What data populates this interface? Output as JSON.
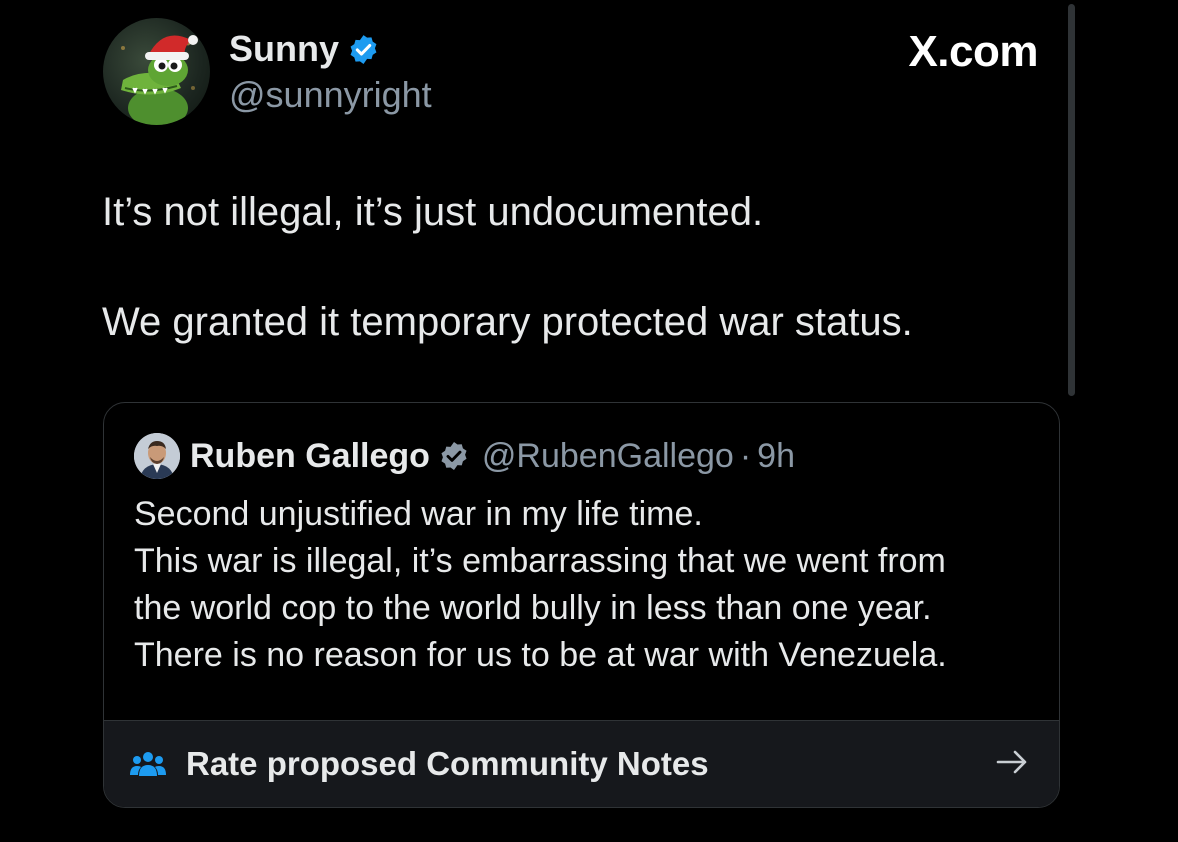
{
  "post": {
    "author_name": "Sunny",
    "author_handle": "@sunnyright",
    "brand": "X.com",
    "verified": true,
    "paragraphs": [
      "It’s not illegal, it’s just undocumented.",
      "We granted it temporary protected war status."
    ]
  },
  "quoted_post": {
    "author_name": "Ruben Gallego",
    "author_handle": "@RubenGallego",
    "separator": "·",
    "time": "9h",
    "verified": true,
    "lines": [
      "Second unjustified war in my life time.",
      "This war is illegal, it’s embarrassing that we went from",
      "the world cop to the world bully in less than one year.",
      "There is no reason for us to be at war with Venezuela."
    ]
  },
  "community_notes": {
    "label": "Rate proposed Community Notes",
    "icon": "people-icon",
    "arrow_icon": "arrow-right-icon"
  },
  "colors": {
    "background": "#000000",
    "text_primary": "#e7e9ea",
    "text_secondary": "#8b98a5",
    "verified_badge": "#1d9bf0",
    "border": "#2f3336",
    "notes_bar": "#16181c"
  }
}
